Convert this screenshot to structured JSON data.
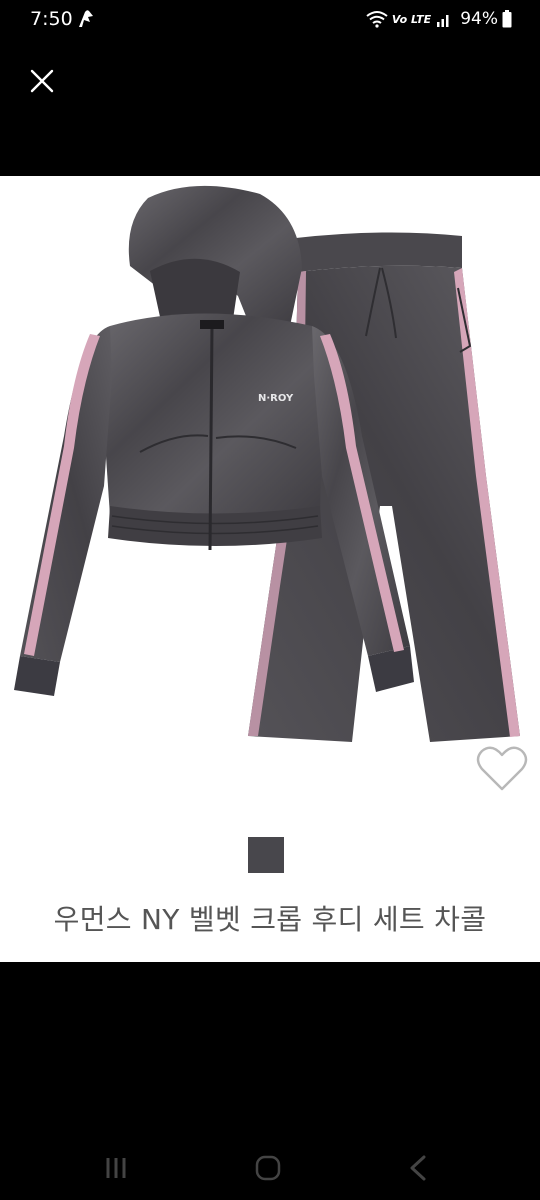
{
  "status_bar": {
    "time": "7:50",
    "network_label": "Vo LTE",
    "battery_text": "94%",
    "battery_level": 0.94
  },
  "toolbar": {
    "close_icon": "close-icon"
  },
  "product": {
    "image_icon": "velvet-tracksuit-image",
    "brand_mark": "N·ROY",
    "favorite_icon": "heart-outline-icon",
    "swatch_color": "#48474c",
    "title": "우먼스 NY 벨벳 크롭 후디 세트 차콜"
  },
  "nav_bar": {
    "recents_icon": "recents-icon",
    "home_icon": "home-icon",
    "back_icon": "back-icon"
  },
  "colors": {
    "background": "#000000",
    "card": "#ffffff",
    "velvet": "#4c4a50",
    "stripe": "#d6a6b9",
    "title_text": "#555555"
  }
}
